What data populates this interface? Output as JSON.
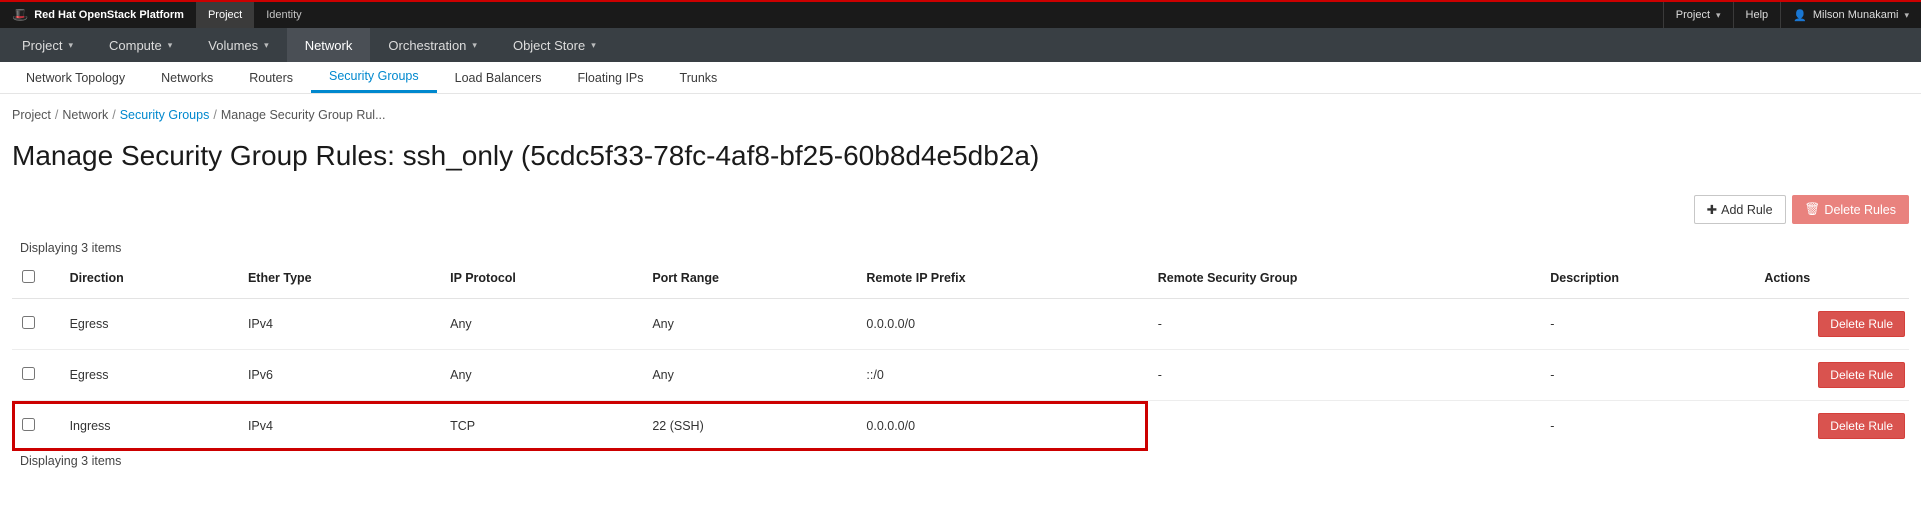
{
  "brand": {
    "label": "Red Hat OpenStack Platform"
  },
  "top_tabs": {
    "project": "Project",
    "identity": "Identity"
  },
  "top_right": {
    "project_menu": "Project",
    "help": "Help",
    "user": "Milson Munakami"
  },
  "nav": {
    "project": "Project",
    "compute": "Compute",
    "volumes": "Volumes",
    "network": "Network",
    "orchestration": "Orchestration",
    "object_store": "Object Store"
  },
  "subtabs": {
    "network_topology": "Network Topology",
    "networks": "Networks",
    "routers": "Routers",
    "security_groups": "Security Groups",
    "load_balancers": "Load Balancers",
    "floating_ips": "Floating IPs",
    "trunks": "Trunks"
  },
  "breadcrumb": {
    "project": "Project",
    "network": "Network",
    "security_groups": "Security Groups",
    "current": "Manage Security Group Rul..."
  },
  "heading": "Manage Security Group Rules: ssh_only (5cdc5f33-78fc-4af8-bf25-60b8d4e5db2a)",
  "actions": {
    "add_rule": "Add Rule",
    "delete_rules": "Delete Rules",
    "delete_rule": "Delete Rule"
  },
  "table": {
    "display_top": "Displaying 3 items",
    "display_bottom": "Displaying 3 items",
    "headers": {
      "direction": "Direction",
      "ether_type": "Ether Type",
      "ip_protocol": "IP Protocol",
      "port_range": "Port Range",
      "remote_ip_prefix": "Remote IP Prefix",
      "remote_security_group": "Remote Security Group",
      "description": "Description",
      "actions": "Actions"
    },
    "rows": [
      {
        "direction": "Egress",
        "ether_type": "IPv4",
        "ip_protocol": "Any",
        "port_range": "Any",
        "remote_ip_prefix": "0.0.0.0/0",
        "remote_security_group": "-",
        "description": "-"
      },
      {
        "direction": "Egress",
        "ether_type": "IPv6",
        "ip_protocol": "Any",
        "port_range": "Any",
        "remote_ip_prefix": "::/0",
        "remote_security_group": "-",
        "description": "-"
      },
      {
        "direction": "Ingress",
        "ether_type": "IPv4",
        "ip_protocol": "TCP",
        "port_range": "22 (SSH)",
        "remote_ip_prefix": "0.0.0.0/0",
        "remote_security_group": "",
        "description": "-"
      }
    ]
  },
  "highlight": {
    "row_index": 2,
    "cols_up_to": 5
  }
}
